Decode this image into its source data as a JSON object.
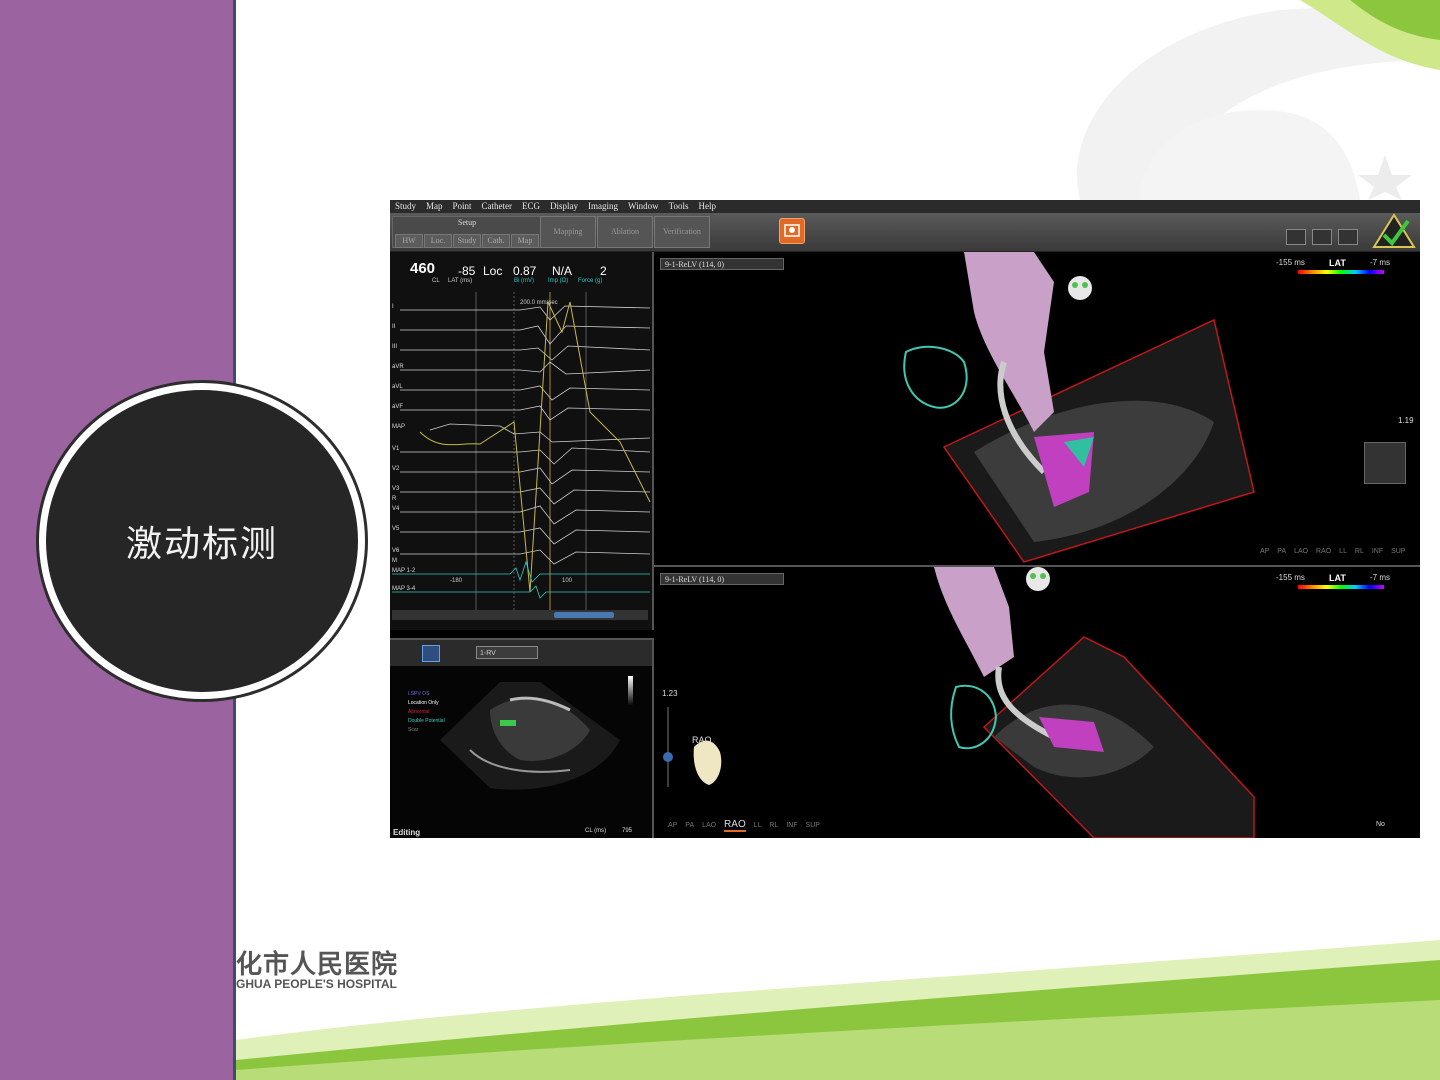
{
  "slide": {
    "title": "激动标测",
    "logo_cn": "化市人民医院",
    "logo_en": "GHUA PEOPLE'S HOSPITAL",
    "colors": {
      "sidebar": "#9b64a0",
      "circle": "#262626",
      "wave": "#8cc63f"
    }
  },
  "app": {
    "menu": [
      "Study",
      "Map",
      "Point",
      "Catheter",
      "ECG",
      "Display",
      "Imaging",
      "Window",
      "Tools",
      "Help"
    ],
    "toolbar": {
      "setup_label": "Setup",
      "setup_tabs": [
        "HW",
        "Loc.",
        "Study",
        "Cath.",
        "Map"
      ],
      "phase_tabs": [
        "Mapping",
        "Ablation",
        "Verification"
      ]
    },
    "ecg": {
      "cl_value": "460",
      "cl_label": "CL",
      "lat_value": "-85",
      "lat_label": "LAT (ms)",
      "loc_value": "Loc",
      "bi_value": "0.87",
      "bi_label": "Bi (mV)",
      "imp_value": "N/A",
      "imp_label": "Imp (Ω)",
      "force_value": "2",
      "force_label": "Force (g)",
      "speed": "200.0 mm/sec",
      "window_left": "-180",
      "window_right": "100",
      "leads": [
        "I",
        "II",
        "III",
        "aVR",
        "aVL",
        "aVF",
        "MAP",
        "V1",
        "V2",
        "V3",
        "R",
        "V4",
        "V5",
        "V6",
        "M",
        "MAP 1-2",
        "MAP 3-4"
      ]
    },
    "echo": {
      "catheter_select": "1-RV",
      "legend": [
        "LSPV OS",
        "Location Only",
        "Abnormal",
        "Double Potential",
        "Scar"
      ],
      "status": "Editing",
      "cl_label": "CL (ms)",
      "cl_value": "795"
    },
    "map_top": {
      "map_select": "9-1-ReLV (114, 0)",
      "lat_min": "-155 ms",
      "lat_title": "LAT",
      "lat_max": "-7 ms",
      "zoom": "1.19",
      "views": [
        "AP",
        "PA",
        "LAO",
        "RAO",
        "LL",
        "RL",
        "INF",
        "SUP"
      ]
    },
    "map_bottom": {
      "map_select": "9-1-ReLV (114, 0)",
      "lat_min": "-155 ms",
      "lat_title": "LAT",
      "lat_max": "-7 ms",
      "zoom": "1.23",
      "orientation": "RAO",
      "views": [
        "AP",
        "PA",
        "LAO",
        "RAO",
        "LL",
        "RL",
        "INF",
        "SUP"
      ],
      "active_view": "RAO",
      "corner_label": "No"
    }
  }
}
